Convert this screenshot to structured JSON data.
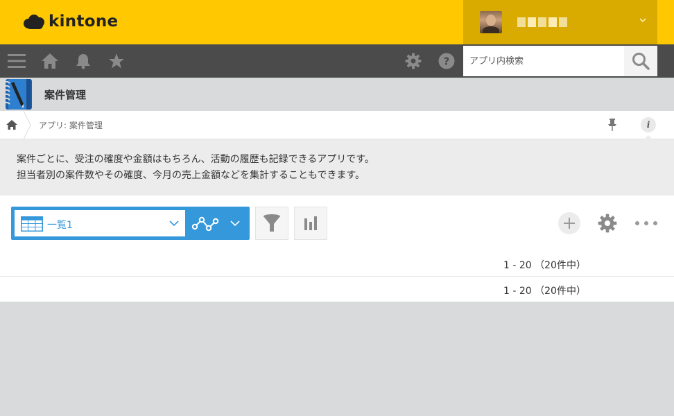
{
  "header": {
    "logo_text": "kintone",
    "colors": {
      "header_bg": "#ffc800",
      "user_area_bg": "#d9aa00",
      "nav_bg": "#4b4b4b",
      "accent": "#3498db"
    }
  },
  "nav": {
    "icons": [
      "menu-icon",
      "home-icon",
      "bell-icon",
      "star-icon",
      "gear-icon",
      "help-icon"
    ],
    "search": {
      "placeholder": "アプリ内検索",
      "value": ""
    }
  },
  "app": {
    "title": "案件管理"
  },
  "breadcrumb": {
    "text": "アプリ: 案件管理"
  },
  "description": {
    "line1": "案件ごとに、受注の確度や金額はもちろん、活動の履歴も記録できるアプリです。",
    "line2": "担当者別の案件数やその確度、今月の売上金額などを集計することもできます。"
  },
  "toolbar": {
    "view_label": "一覧1"
  },
  "pagination": {
    "top": "1 - 20 （20件中）",
    "bottom": "1 - 20 （20件中）"
  }
}
